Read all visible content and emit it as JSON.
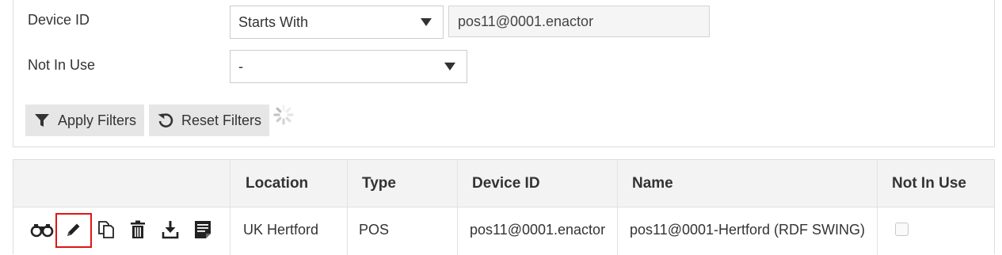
{
  "filters": {
    "device_id": {
      "label": "Device ID",
      "operator": "Starts With",
      "value": "pos11@0001.enactor"
    },
    "not_in_use": {
      "label": "Not In Use",
      "value": "-"
    },
    "apply_label": "Apply Filters",
    "reset_label": "Reset Filters"
  },
  "table": {
    "columns": [
      "Location",
      "Type",
      "Device ID",
      "Name",
      "Not In Use"
    ],
    "rows": [
      {
        "location": "UK Hertford",
        "type": "POS",
        "device_id": "pos11@0001.enactor",
        "name": "pos11@0001-Hertford (RDF SWING)",
        "not_in_use": false
      }
    ],
    "row_actions": [
      "view-binoculars-icon",
      "edit-pencil-icon",
      "copy-icon",
      "delete-trash-icon",
      "download-icon",
      "details-list-icon"
    ]
  },
  "colors": {
    "highlight": "#e01515",
    "header_bg": "#f3f3f3",
    "button_bg": "#e6e6e6"
  }
}
